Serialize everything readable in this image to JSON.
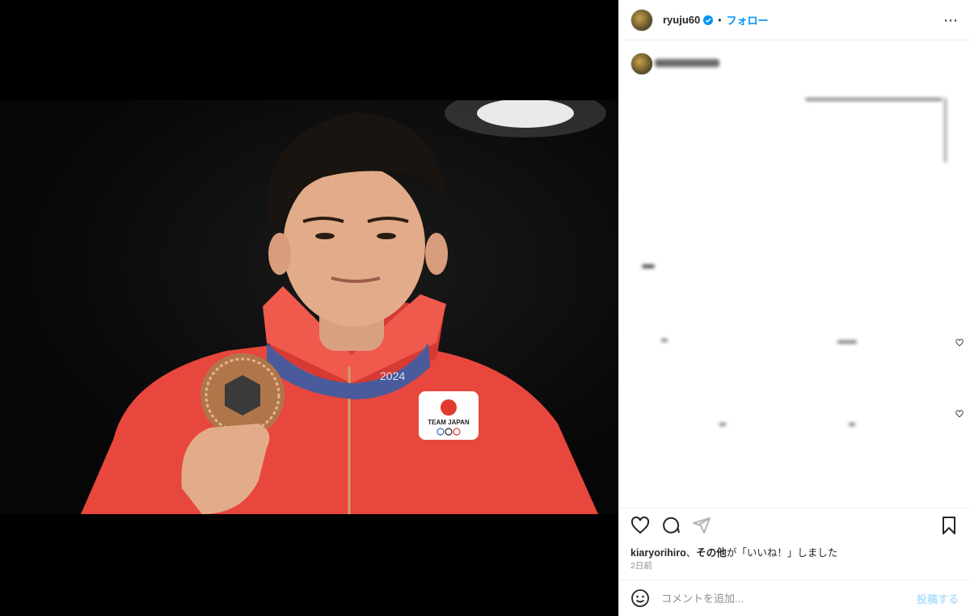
{
  "post": {
    "username": "ryuju60",
    "follow_label": "フォロー",
    "separator": "•"
  },
  "engagement": {
    "liked_by_user": "kiaryorihiro",
    "liked_by_tail_prefix": "、",
    "liked_by_others": "その他",
    "liked_by_tail_suffix": "が「いいね！」しました",
    "time_ago": "2日前"
  },
  "comment_box": {
    "placeholder": "コメントを追加...",
    "post_label": "投稿する"
  },
  "photo": {
    "emblem_text": "TEAM JAPAN",
    "ribbon_text": "2024"
  },
  "colors": {
    "accent": "#0095f6",
    "post_disabled": "#b2dffc",
    "jacket_red": "#e8473d",
    "medal_bronze": "#b0764a"
  }
}
